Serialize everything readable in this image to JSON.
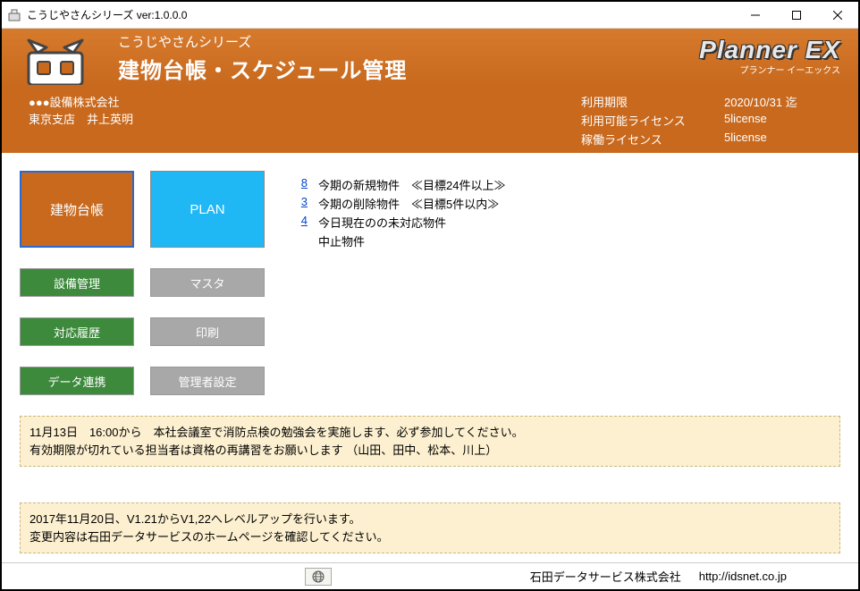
{
  "window": {
    "title": "こうじやさんシリーズ  ver:1.0.0.0"
  },
  "header": {
    "series": "こうじやさんシリーズ",
    "appname": "建物台帳・スケジュール管理",
    "logo": "Planner EX",
    "logo_sub": "プランナー イーエックス"
  },
  "company": {
    "name": "●●●設備株式会社",
    "branch_user": "東京支店　井上英明"
  },
  "license": {
    "expire_label": "利用期限",
    "expire_value": "2020/10/31 迄",
    "available_label": "利用可能ライセンス",
    "available_value": "5license",
    "active_label": "稼働ライセンス",
    "active_value": "5license"
  },
  "buttons": {
    "building": "建物台帳",
    "plan": "PLAN",
    "equipment": "設備管理",
    "master": "マスタ",
    "history": "対応履歴",
    "print": "印刷",
    "datalink": "データ連携",
    "admin": "管理者設定"
  },
  "announcements": [
    {
      "num": "8",
      "text": "今期の新規物件　≪目標24件以上≫"
    },
    {
      "num": "3",
      "text": "今期の削除物件　≪目標5件以内≫"
    },
    {
      "num": "4",
      "text": "今日現在のの未対応物件"
    },
    {
      "num": "",
      "text": "中止物件"
    }
  ],
  "notice1_line1": "11月13日　16:00から　本社会議室で消防点検の勉強会を実施します、必ず参加してください。",
  "notice1_line2": "有効期限が切れている担当者は資格の再講習をお願いします （山田、田中、松本、川上）",
  "notice2_line1": "2017年11月20日、V1.21からV1,22へレベルアップを行います。",
  "notice2_line2": "変更内容は石田データサービスのホームページを確認してください。",
  "footer": {
    "company": "石田データサービス株式会社",
    "url": "http://idsnet.co.jp"
  }
}
